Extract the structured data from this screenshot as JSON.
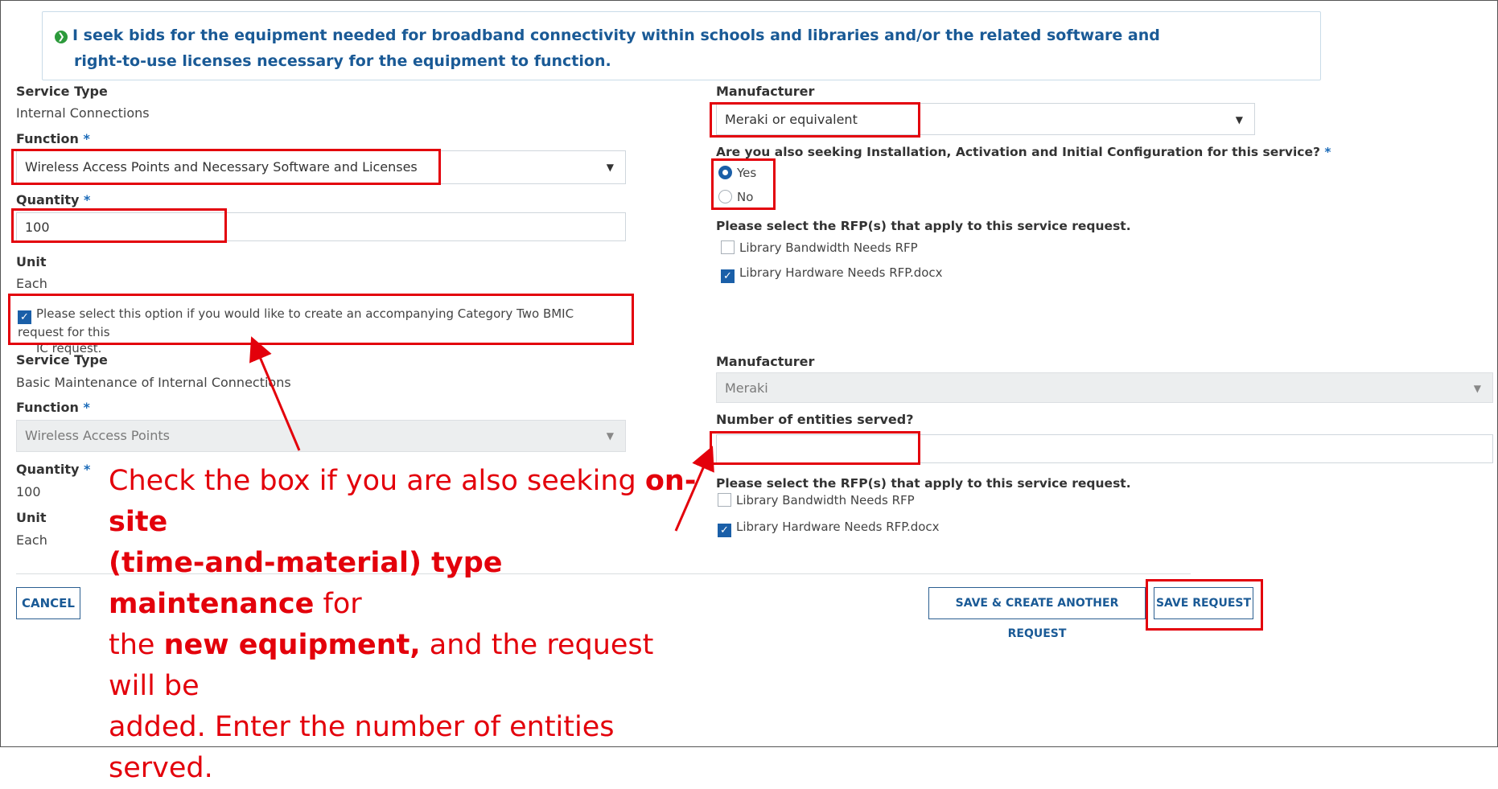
{
  "banner": {
    "line1": "I seek bids for the equipment needed for broadband connectivity within schools and libraries and/or the related software and",
    "line2": "right-to-use licenses necessary for the  equipment to function."
  },
  "ic": {
    "service_type_label": "Service Type",
    "service_type_value": "Internal Connections",
    "function_label": "Function",
    "function_value": "Wireless Access Points and Necessary Software and Licenses",
    "quantity_label": "Quantity",
    "quantity_value": "100",
    "unit_label": "Unit",
    "unit_value": "Each",
    "manufacturer_label": "Manufacturer",
    "manufacturer_value": "Meraki or equivalent",
    "installation_question": "Are you also seeking Installation, Activation and Initial Configuration for this service?",
    "yes_label": "Yes",
    "no_label": "No",
    "rfp_label": "Please select the RFP(s) that apply to this service request.",
    "rfp_options": [
      {
        "label": "Library Bandwidth Needs RFP",
        "checked": false
      },
      {
        "label": "Library Hardware Needs RFP.docx",
        "checked": true
      }
    ]
  },
  "bmic_option": {
    "line1": "Please select this option if you would like to create an accompanying Category Two BMIC request for this",
    "line2": "IC request."
  },
  "bmic": {
    "service_type_label": "Service Type",
    "service_type_value": "Basic Maintenance of Internal Connections",
    "function_label": "Function",
    "function_value": "Wireless Access Points",
    "quantity_label": "Quantity",
    "quantity_value": "100",
    "unit_label": "Unit",
    "unit_value": "Each",
    "manufacturer_label": "Manufacturer",
    "manufacturer_value": "Meraki",
    "entities_label": "Number of entities served?",
    "entities_value": "",
    "rfp_label": "Please select the RFP(s) that apply to this service request.",
    "rfp_options": [
      {
        "label": "Library Bandwidth Needs RFP",
        "checked": false
      },
      {
        "label": "Library Hardware Needs RFP.docx",
        "checked": true
      }
    ]
  },
  "callout": {
    "l1a": "Check the box if you are also seeking ",
    "l1b": "on-site",
    "l2a": "(time-and-material) type maintenance",
    "l2b": " for",
    "l3a": "the ",
    "l3b": "new equipment,",
    "l3c": " and the request will be",
    "l4": "added. Enter the number of entities served."
  },
  "required_mark": "*",
  "buttons": {
    "cancel": "CANCEL",
    "save_create": "SAVE & CREATE ANOTHER REQUEST",
    "save": "SAVE REQUEST"
  },
  "colors": {
    "highlight": "#e3000b",
    "link_blue": "#1a5a96",
    "check_blue": "#1a5fa8"
  }
}
